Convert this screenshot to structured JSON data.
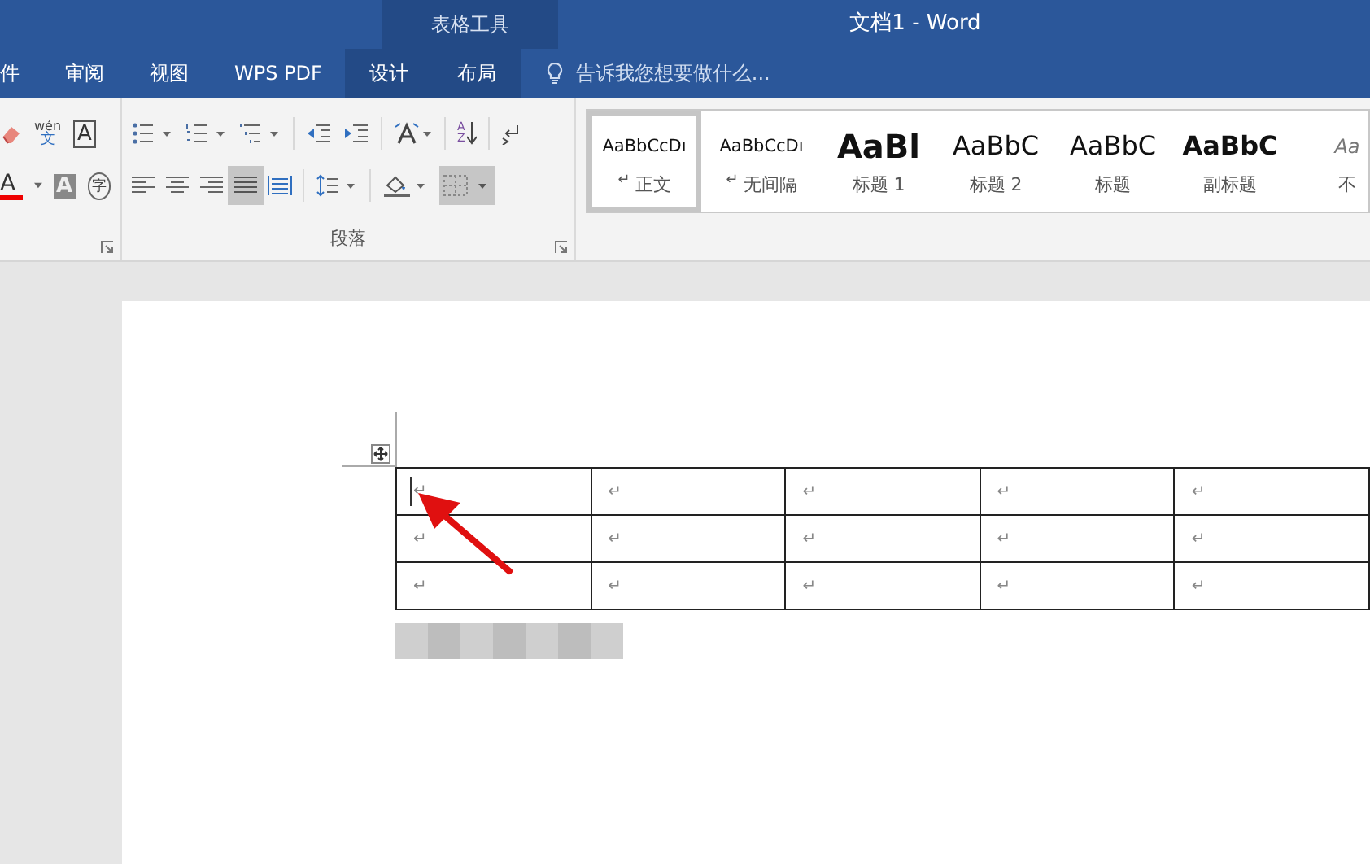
{
  "window": {
    "title": "文档1 - Word",
    "context_group": "表格工具"
  },
  "tabs": [
    {
      "label": "件",
      "context": false,
      "selected": false
    },
    {
      "label": "审阅",
      "context": false,
      "selected": false
    },
    {
      "label": "视图",
      "context": false,
      "selected": false
    },
    {
      "label": "WPS PDF",
      "context": false,
      "selected": false
    },
    {
      "label": "设计",
      "context": true,
      "selected": false
    },
    {
      "label": "布局",
      "context": true,
      "selected": false
    }
  ],
  "tell_me": {
    "placeholder": "告诉我您想要做什么..."
  },
  "font_group": {
    "phonetic": "wén",
    "phonetic_char": "文",
    "border_char": "A",
    "color_char": "A",
    "shading_char": "A",
    "enclose_char": "字"
  },
  "paragraph_group": {
    "label": "段落",
    "sort_letters": [
      "A",
      "Z"
    ],
    "align_buttons": [
      {
        "kind": "left",
        "selected": false
      },
      {
        "kind": "center",
        "selected": false
      },
      {
        "kind": "right",
        "selected": false
      },
      {
        "kind": "justify",
        "selected": true
      },
      {
        "kind": "distributed",
        "selected": false
      }
    ],
    "borders_selected": true
  },
  "styles": [
    {
      "preview": "AaBbCcDı",
      "kind": "normal",
      "marker": "↵",
      "name": "正文",
      "selected": true
    },
    {
      "preview": "AaBbCcDı",
      "kind": "normal",
      "marker": "↵",
      "name": "无间隔",
      "selected": false
    },
    {
      "preview": "AaBl",
      "kind": "heading1",
      "name": "标题 1",
      "selected": false
    },
    {
      "preview": "AaBbC",
      "kind": "heading2",
      "name": "标题 2",
      "selected": false
    },
    {
      "preview": "AaBbC",
      "kind": "heading2",
      "name": "标题",
      "selected": false
    },
    {
      "preview": "AaBbC",
      "kind": "subtitle",
      "name": "副标题",
      "selected": false
    },
    {
      "preview": "Aa",
      "kind": "emphasis",
      "name": "不",
      "selected": false
    }
  ],
  "table": {
    "rows": [
      [
        "↵",
        "↵",
        "↵",
        "↵",
        "↵"
      ],
      [
        "↵",
        "↵",
        "↵",
        "↵",
        "↵"
      ],
      [
        "↵",
        "↵",
        "↵",
        "↵",
        "↵"
      ]
    ],
    "cursor_in_first_cell": true
  }
}
